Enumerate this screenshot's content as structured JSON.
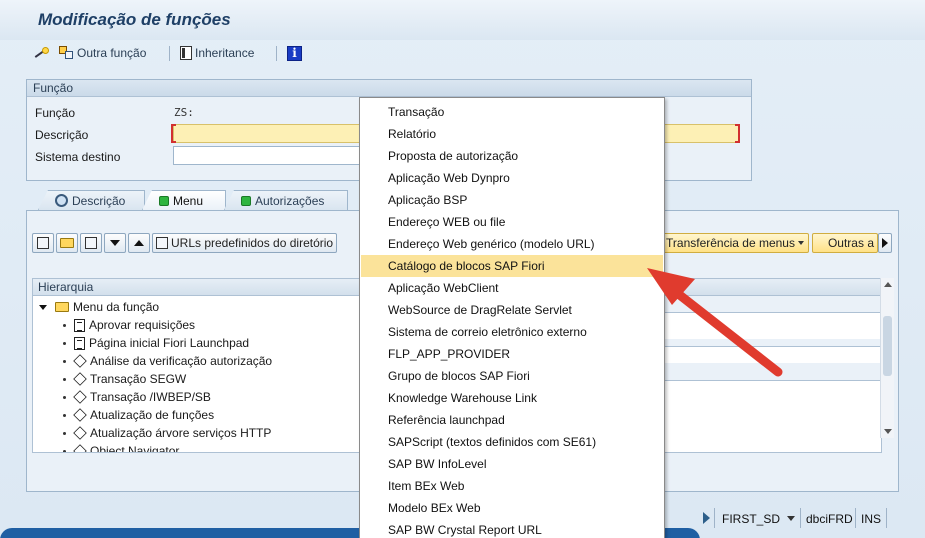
{
  "window": {
    "title": "Modificação de funções"
  },
  "toolbar": {
    "other_function_label": "Outra função",
    "inheritance_label": "Inheritance"
  },
  "function_group": {
    "header": "Função",
    "function_label": "Função",
    "function_value": "ZS:",
    "description_label": "Descrição",
    "description_value": "",
    "target_system_label": "Sistema destino",
    "target_system_value": ""
  },
  "tabs": [
    {
      "label": "Descrição"
    },
    {
      "label": "Menu"
    },
    {
      "label": "Autorizações"
    }
  ],
  "menu_toolbar": {
    "predefined_urls_label": "URLs predefinidos do diretório",
    "menu_transfer_label": "Transferência de menus",
    "others_label": "Outras a"
  },
  "tree": {
    "header": "Hierarquia",
    "root_label": "Menu da função",
    "items": [
      {
        "label": "Aprovar requisições",
        "icon": "page-icon"
      },
      {
        "label": "Página inicial Fiori Launchpad",
        "icon": "page-icon"
      },
      {
        "label": "Análise da verificação autorização",
        "icon": "cube-icon"
      },
      {
        "label": "Transação SEGW",
        "icon": "cube-icon"
      },
      {
        "label": "Transação /IWBEP/SB",
        "icon": "cube-icon"
      },
      {
        "label": "Atualização de funções",
        "icon": "cube-icon"
      },
      {
        "label": "Atualização árvore serviços HTTP",
        "icon": "cube-icon"
      },
      {
        "label": "Object Navigator",
        "icon": "cube-icon"
      }
    ]
  },
  "dropdown": {
    "items": [
      {
        "label": "Transação"
      },
      {
        "label": "Relatório"
      },
      {
        "label": "Proposta de autorização"
      },
      {
        "label": "Aplicação Web Dynpro"
      },
      {
        "label": "Aplicação BSP"
      },
      {
        "label": "Endereço WEB ou file"
      },
      {
        "label": "Endereço Web genérico (modelo URL)"
      },
      {
        "label": "Catálogo de blocos SAP Fiori"
      },
      {
        "label": "Aplicação WebClient"
      },
      {
        "label": "WebSource de DragRelate Servlet"
      },
      {
        "label": "Sistema de correio eletrônico externo"
      },
      {
        "label": "FLP_APP_PROVIDER"
      },
      {
        "label": "Grupo de blocos SAP Fiori"
      },
      {
        "label": "Knowledge Warehouse Link"
      },
      {
        "label": "Referência launchpad"
      },
      {
        "label": "SAPScript (textos definidos com SE61)"
      },
      {
        "label": "SAP BW InfoLevel"
      },
      {
        "label": "Item BEx Web"
      },
      {
        "label": "Modelo BEx Web"
      },
      {
        "label": "SAP BW  Crystal Report  URL"
      }
    ],
    "highlighted_item": "Catálogo de blocos SAP Fiori",
    "highlight_color": "#fbe39a"
  },
  "status_bar": {
    "system": "FIRST_SD",
    "server": "dbciFRD",
    "mode": "INS"
  },
  "colors": {
    "arrow": "#e03b2e",
    "title": "#1e3f66",
    "status_band": "#1f5fa3"
  }
}
